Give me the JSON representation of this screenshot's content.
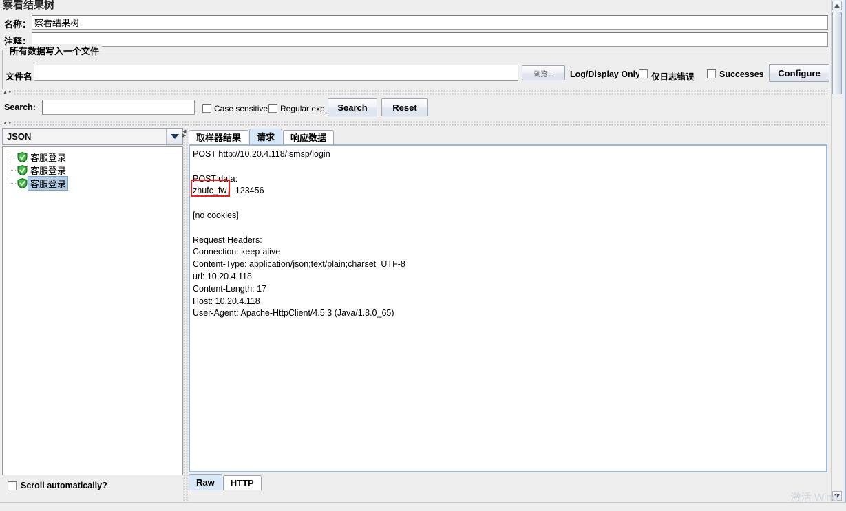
{
  "window": {
    "title": "察看结果树"
  },
  "form": {
    "name_label": "名称：",
    "name_value": "察看结果树",
    "comment_label": "注释：",
    "comment_value": ""
  },
  "filegroup": {
    "title": "所有数据写入一个文件",
    "filename_label": "文件名",
    "filename_value": "",
    "browse_label": "浏览...",
    "log_display_label": "Log/Display Only:",
    "errors_only_label": "仅日志错误",
    "errors_only_checked": false,
    "successes_label": "Successes",
    "successes_checked": false,
    "configure_label": "Configure"
  },
  "search": {
    "label": "Search:",
    "value": "",
    "case_sensitive_label": "Case sensitive",
    "case_sensitive_checked": false,
    "regex_label": "Regular exp.",
    "regex_checked": false,
    "search_button": "Search",
    "reset_button": "Reset"
  },
  "left": {
    "renderer_selected": "JSON",
    "tree_items": [
      {
        "label": "客服登录",
        "status": "success",
        "selected": false
      },
      {
        "label": "客服登录",
        "status": "success",
        "selected": false
      },
      {
        "label": "客服登录",
        "status": "success",
        "selected": true
      }
    ],
    "scroll_auto_label": "Scroll automatically?",
    "scroll_auto_checked": false
  },
  "right": {
    "tabs": [
      {
        "label": "取样器结果",
        "active": false
      },
      {
        "label": "请求",
        "active": true
      },
      {
        "label": "响应数据",
        "active": false
      }
    ],
    "body": "POST http://10.20.4.118/lsmsp/login\n\nPOST data:\nzhufc_fw，123456\n\n[no cookies]\n\nRequest Headers:\nConnection: keep-alive\nContent-Type: application/json;text/plain;charset=UTF-8\nurl: 10.20.4.118\nContent-Length: 17\nHost: 10.20.4.118\nUser-Agent: Apache-HttpClient/4.5.3 (Java/1.8.0_65)",
    "highlight_color": "#ee1c1c",
    "bottom_tabs": [
      {
        "label": "Raw",
        "active": true
      },
      {
        "label": "HTTP",
        "active": false
      }
    ]
  },
  "overlay": {
    "watermark": "激活 Wind"
  }
}
